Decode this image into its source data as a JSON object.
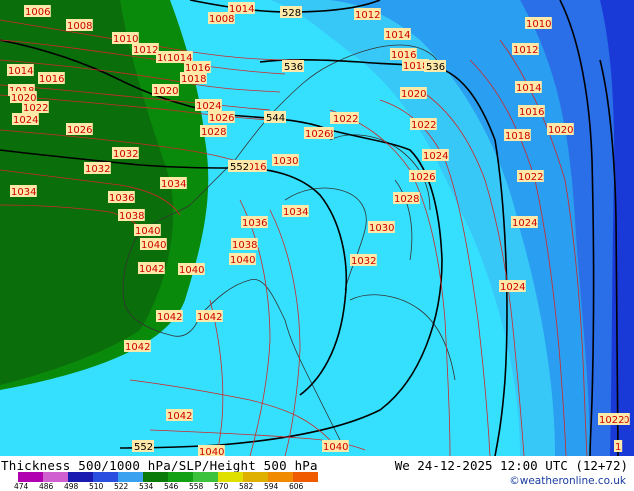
{
  "map": {
    "isobar_labels": [
      "1006",
      "1008",
      "1008",
      "1010",
      "1012",
      "1012",
      "1014",
      "1016",
      "1014",
      "1016",
      "1018",
      "1018",
      "1020",
      "1020",
      "1022",
      "1024",
      "1024",
      "1026",
      "1026",
      "1028",
      "1028",
      "1030",
      "1032",
      "1034",
      "1034",
      "1036",
      "1038",
      "1040",
      "1040",
      "1042",
      "1042",
      "1042",
      "1042",
      "1040",
      "1036",
      "1038",
      "1040",
      "1034",
      "1032",
      "1032",
      "1030",
      "1028",
      "1026",
      "1026",
      "1024",
      "1024",
      "1022",
      "1020",
      "1018",
      "1016",
      "1014",
      "1012",
      "1010",
      "1022",
      "1020",
      "1018",
      "1016",
      "1014",
      "1014",
      "1016",
      "1012",
      "1024",
      "1024",
      "1022",
      "1020",
      "1042",
      "1040",
      "1040",
      "1022",
      "1"
    ],
    "height_labels": [
      "528",
      "536",
      "536",
      "544",
      "552",
      "552"
    ]
  },
  "footer": {
    "title": "Thickness 500/1000 hPa/SLP/Height 500 hPa",
    "valid_time": "We 24-12-2025 12:00 UTC (12+72)",
    "credit": "©weatheronline.co.uk",
    "scale_values": [
      "474",
      "486",
      "498",
      "510",
      "522",
      "534",
      "546",
      "558",
      "570",
      "582",
      "594",
      "606"
    ],
    "scale_colors": [
      "#b000b0",
      "#d060d0",
      "#1a1ab0",
      "#2a4fe0",
      "#3aa0f0",
      "#0a7a0a",
      "#14a014",
      "#3cc23c",
      "#e0e000",
      "#e0b000",
      "#f08a00",
      "#f05a00"
    ]
  },
  "colors": {
    "thickness_dark_green": "#0a6e0a",
    "thickness_green": "#0a8a0a",
    "thickness_cyan": "#35e0ff",
    "thickness_light_blue": "#38c8f8",
    "thickness_mid_blue": "#2a9ef0",
    "thickness_blue": "#2a6ee8",
    "thickness_deep_blue": "#1a3ad8",
    "isobar": "#cc2a2a",
    "height_contour": "#000000",
    "coastline": "#333333"
  }
}
